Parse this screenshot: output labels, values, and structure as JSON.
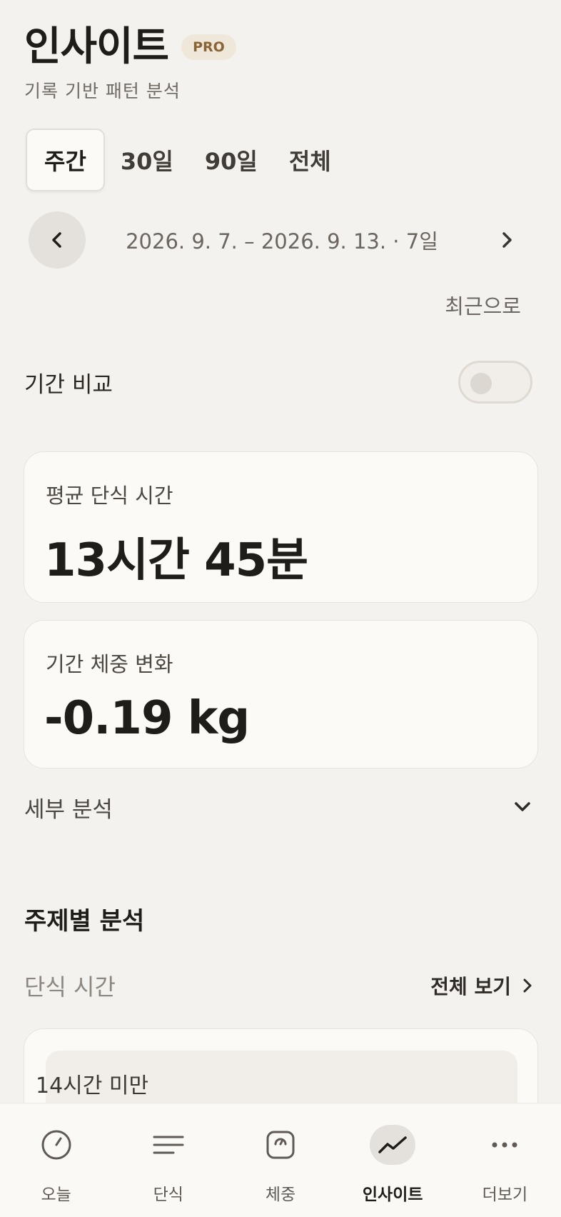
{
  "header": {
    "title": "인사이트",
    "badge": "PRO",
    "subtitle": "기록 기반 패턴 분석"
  },
  "tabs": [
    {
      "label": "주간",
      "active": true
    },
    {
      "label": "30일",
      "active": false
    },
    {
      "label": "90일",
      "active": false
    },
    {
      "label": "전체",
      "active": false
    }
  ],
  "date_nav": {
    "range": "2026. 9. 7. – 2026. 9. 13. · 7일",
    "recent_label": "최근으로",
    "prev_icon": "chevron-left-icon",
    "next_icon": "chevron-right-icon"
  },
  "compare": {
    "label": "기간 비교",
    "enabled": false
  },
  "stats": [
    {
      "label": "평균 단식 시간",
      "value": "13시간 45분"
    },
    {
      "label": "기간 체중 변화",
      "value": "-0.19 kg"
    }
  ],
  "detail": {
    "label": "세부 분석",
    "icon": "chevron-down-icon"
  },
  "topics": {
    "title": "주제별 분석",
    "subsection_label": "단식 시간",
    "view_all_label": "전체 보기",
    "first_bucket": "14시간 미만"
  },
  "bottom_nav": [
    {
      "label": "오늘",
      "icon": "clock-icon",
      "active": false
    },
    {
      "label": "단식",
      "icon": "lines-icon",
      "active": false
    },
    {
      "label": "체중",
      "icon": "scale-icon",
      "active": false
    },
    {
      "label": "인사이트",
      "icon": "trend-icon",
      "active": true
    },
    {
      "label": "더보기",
      "icon": "more-icon",
      "active": false
    }
  ],
  "colors": {
    "background": "#f4f2ee",
    "card": "#fbfaf7",
    "badge_bg": "#efe7da",
    "badge_text": "#8a6434"
  }
}
